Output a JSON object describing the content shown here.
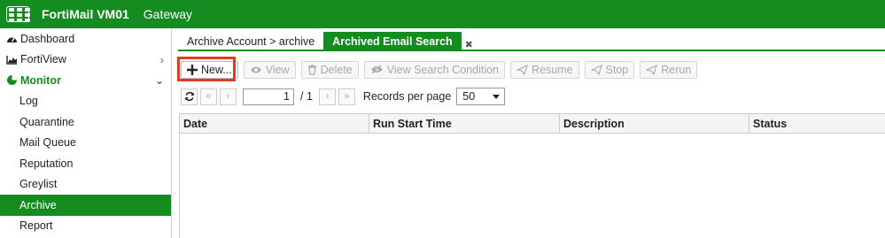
{
  "header": {
    "product_name": "FortiMail VM01",
    "mode": "Gateway"
  },
  "sidebar": {
    "items": [
      {
        "label": "Dashboard",
        "icon": "dashboard-icon"
      },
      {
        "label": "FortiView",
        "icon": "chart-icon"
      },
      {
        "label": "Monitor",
        "icon": "monitor-pie-icon"
      },
      {
        "label": "Log"
      },
      {
        "label": "Quarantine"
      },
      {
        "label": "Mail Queue"
      },
      {
        "label": "Reputation"
      },
      {
        "label": "Greylist"
      },
      {
        "label": "Archive"
      },
      {
        "label": "Report"
      }
    ]
  },
  "tabs": [
    {
      "label": "Archive Account > archive"
    },
    {
      "label": "Archived Email Search"
    }
  ],
  "toolbar": {
    "new_label": "New...",
    "view_label": "View",
    "delete_label": "Delete",
    "view_search_condition_label": "View Search Condition",
    "resume_label": "Resume",
    "stop_label": "Stop",
    "rerun_label": "Rerun"
  },
  "pager": {
    "current_page": "1",
    "separator": "/",
    "total_pages": "1",
    "records_per_page_label": "Records per page",
    "records_per_page_value": "50"
  },
  "table": {
    "columns": [
      "Date",
      "Run Start Time",
      "Description",
      "Status"
    ]
  },
  "colors": {
    "brand_green": "#148c1f",
    "highlight_red": "#e23b25"
  }
}
